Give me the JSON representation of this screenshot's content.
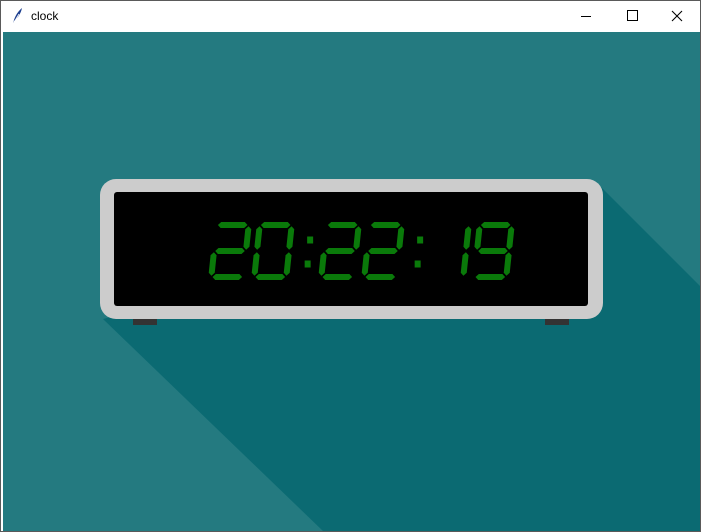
{
  "window": {
    "title": "clock",
    "icon": "feather-icon",
    "controls": [
      "minimize-icon",
      "maximize-icon",
      "close-icon"
    ]
  },
  "clock": {
    "time": "20:22:19"
  },
  "colors": {
    "background": "#247a80",
    "shadow": "#0b6a72",
    "frame": "#cccccc",
    "screen": "#000000",
    "digits": "#0a7a0a",
    "feet": "#333333"
  }
}
